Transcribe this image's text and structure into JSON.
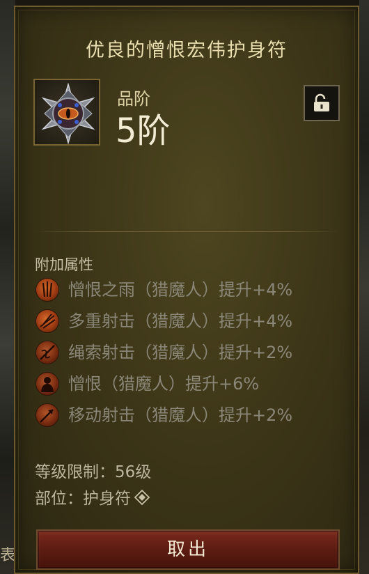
{
  "item": {
    "title": "优良的憎恨宏伟护身符",
    "rank_label": "品阶",
    "rank_value": "5阶",
    "icon": "amulet-gem-icon"
  },
  "lock": {
    "icon": "padlock-open-icon"
  },
  "attributes": {
    "heading": "附加属性",
    "affixes": [
      {
        "icon": "rain-of-vengeance-icon",
        "text": "憎恨之雨（猎魔人）提升+4%"
      },
      {
        "icon": "multishot-icon",
        "text": "多重射击（猎魔人）提升+4%"
      },
      {
        "icon": "entangling-shot-icon",
        "text": "绳索射击（猎魔人）提升+2%"
      },
      {
        "icon": "hatred-icon",
        "text": "憎恨（猎魔人）提升+6%"
      },
      {
        "icon": "evasive-fire-icon",
        "text": "移动射击（猎魔人）提升+2%"
      }
    ]
  },
  "requirements": {
    "level": "等级限制：56级",
    "slot": "部位：护身符"
  },
  "actions": {
    "take_out": "取出"
  },
  "backdrop": {
    "edge_char": "表"
  },
  "colors": {
    "panel": "#3d3618",
    "title": "#e9dfb0",
    "affix_text": "#8a8778",
    "button": "#5c1c12"
  }
}
